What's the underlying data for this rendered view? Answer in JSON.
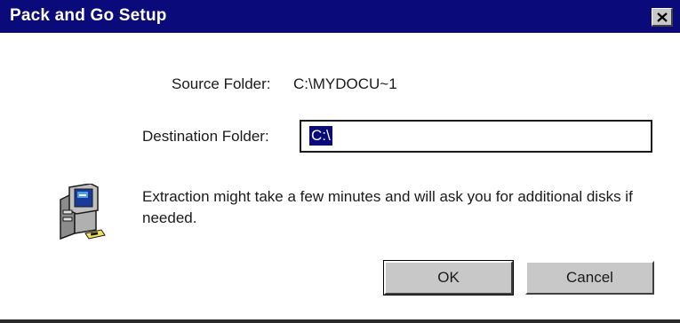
{
  "window": {
    "title": "Pack and Go Setup",
    "close_symbol": "✕"
  },
  "source": {
    "label": "Source Folder:",
    "value": "C:\\MYDOCU~1"
  },
  "destination": {
    "label": "Destination Folder:",
    "value": "C:\\"
  },
  "message": {
    "icon": "computer-icon",
    "text": "Extraction might take a few minutes and will ask you for additional disks if needed."
  },
  "buttons": {
    "ok_label": "OK",
    "cancel_label": "Cancel"
  },
  "colors": {
    "titlebar": "#0a0a7a",
    "selection": "#0a0a7a",
    "button_face": "#c8c8c8"
  }
}
